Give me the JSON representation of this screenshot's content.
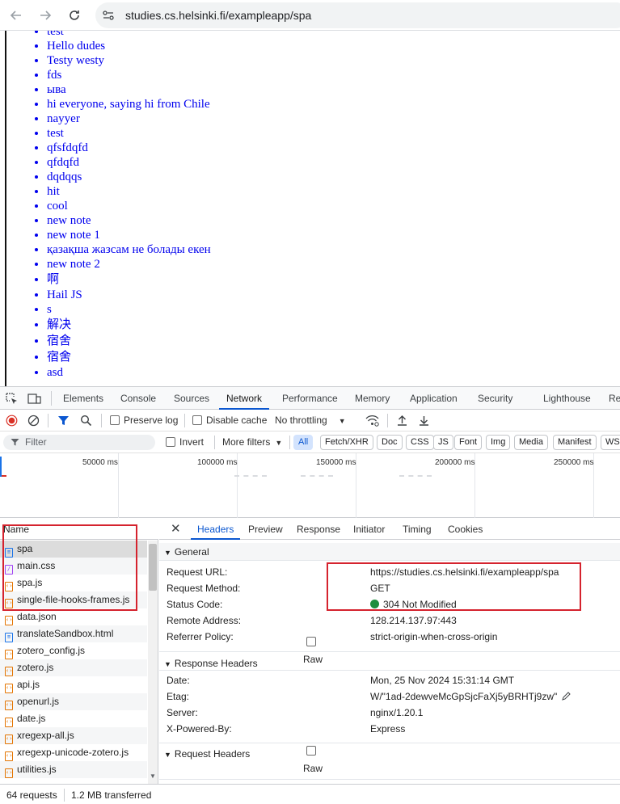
{
  "browser": {
    "url": "studies.cs.helsinki.fi/exampleapp/spa"
  },
  "notes": [
    "test",
    "Hello dudes",
    "Testy westy",
    "fds",
    "ыва",
    "hi everyone, saying hi from Chile",
    "nayyer",
    "test",
    "qfsfdqfd",
    "qfdqfd",
    "dqdqqs",
    "hit",
    "cool",
    "new note",
    "new note 1",
    "қазақша жазсам не болады екен",
    "new note 2",
    "啊",
    "Hail JS",
    "s",
    "解决",
    "宿舍",
    "宿舍",
    "asd"
  ],
  "devtools": {
    "tabs": [
      "Elements",
      "Console",
      "Sources",
      "Network",
      "Performance",
      "Memory",
      "Application",
      "Security",
      "Lighthouse",
      "Re"
    ],
    "active_tab": "Network",
    "toolbar": {
      "preserve_log": "Preserve log",
      "disable_cache": "Disable cache",
      "throttling": "No throttling"
    },
    "filter": {
      "placeholder": "Filter",
      "invert": "Invert",
      "more_filters": "More filters",
      "chips": [
        "All",
        "Fetch/XHR",
        "Doc",
        "CSS",
        "JS",
        "Font",
        "Img",
        "Media",
        "Manifest",
        "WS"
      ]
    },
    "timeline_labels": [
      "50000 ms",
      "100000 ms",
      "150000 ms",
      "200000 ms",
      "250000 ms"
    ],
    "requests": {
      "header": "Name",
      "rows": [
        {
          "name": "spa",
          "type": "doc"
        },
        {
          "name": "main.css",
          "type": "css"
        },
        {
          "name": "spa.js",
          "type": "js"
        },
        {
          "name": "single-file-hooks-frames.js",
          "type": "js"
        },
        {
          "name": "data.json",
          "type": "js"
        },
        {
          "name": "translateSandbox.html",
          "type": "doc"
        },
        {
          "name": "zotero_config.js",
          "type": "js"
        },
        {
          "name": "zotero.js",
          "type": "js"
        },
        {
          "name": "api.js",
          "type": "js"
        },
        {
          "name": "openurl.js",
          "type": "js"
        },
        {
          "name": "date.js",
          "type": "js"
        },
        {
          "name": "xregexp-all.js",
          "type": "js"
        },
        {
          "name": "xregexp-unicode-zotero.js",
          "type": "js"
        },
        {
          "name": "utilities.js",
          "type": "js"
        }
      ]
    },
    "status": {
      "requests": "64 requests",
      "transferred": "1.2 MB transferred"
    },
    "details": {
      "tabs": [
        "Headers",
        "Preview",
        "Response",
        "Initiator",
        "Timing",
        "Cookies"
      ],
      "general_title": "General",
      "general": [
        {
          "key": "Request URL:",
          "value": "https://studies.cs.helsinki.fi/exampleapp/spa"
        },
        {
          "key": "Request Method:",
          "value": "GET"
        },
        {
          "key": "Status Code:",
          "value": "304 Not Modified"
        },
        {
          "key": "Remote Address:",
          "value": "128.214.137.97:443"
        },
        {
          "key": "Referrer Policy:",
          "value": "strict-origin-when-cross-origin"
        }
      ],
      "response_title": "Response Headers",
      "raw_label": "Raw",
      "response": [
        {
          "key": "Date:",
          "value": "Mon, 25 Nov 2024 15:31:14 GMT"
        },
        {
          "key": "Etag:",
          "value": "W/\"1ad-2dewveMcGpSjcFaXj5yBRHTj9zw\""
        },
        {
          "key": "Server:",
          "value": "nginx/1.20.1"
        },
        {
          "key": "X-Powered-By:",
          "value": "Express"
        }
      ],
      "request_title": "Request Headers"
    }
  },
  "colors": {
    "accent": "#0b57d0",
    "highlight": "#d5232e",
    "status_ok": "#1e8e3e"
  }
}
